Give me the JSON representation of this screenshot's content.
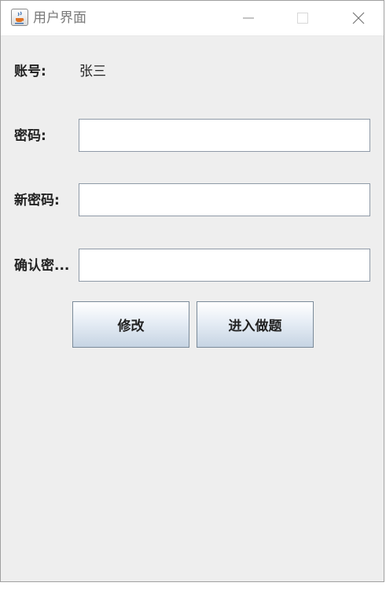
{
  "window": {
    "title": "用户界面"
  },
  "form": {
    "account_label": "账号:",
    "account_value": "张三",
    "password_label": "密码:",
    "new_password_label": "新密码:",
    "confirm_password_label": "确认密...",
    "password_value": "",
    "new_password_value": "",
    "confirm_password_value": ""
  },
  "buttons": {
    "modify_label": "修改",
    "enter_quiz_label": "进入做题"
  },
  "icons": {
    "app": "java-coffee-cup-icon",
    "minimize": "minimize-icon",
    "maximize": "maximize-icon",
    "close": "close-icon"
  }
}
